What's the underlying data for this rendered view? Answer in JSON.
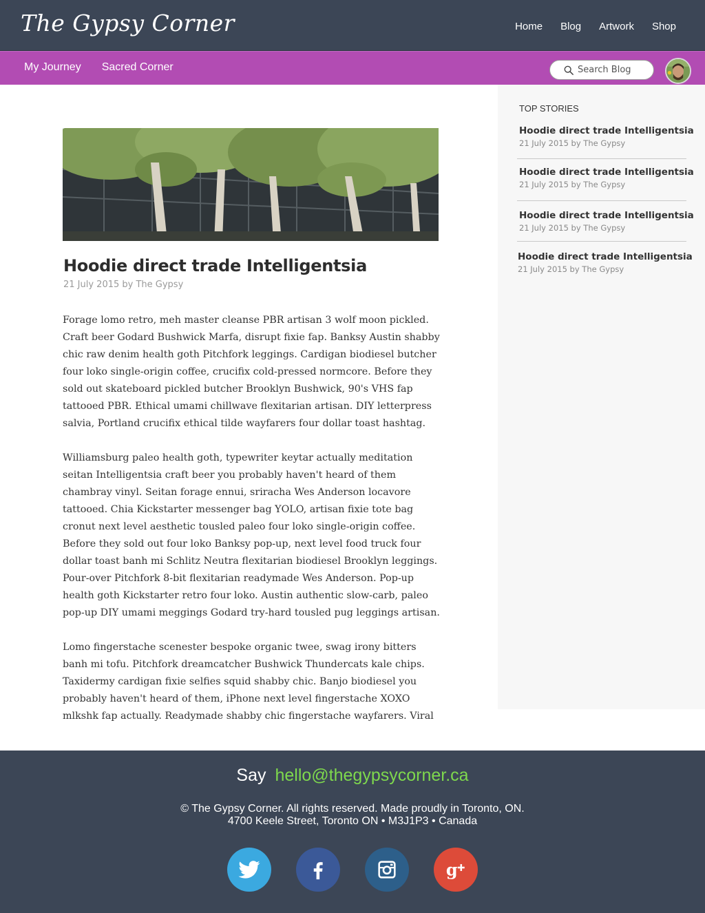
{
  "header": {
    "logo": "The Gypsy Corner",
    "nav": [
      "Home",
      "Blog",
      "Artwork",
      "Shop"
    ]
  },
  "subnav": {
    "items": [
      "My Journey",
      "Sacred Corner"
    ],
    "search_placeholder": "Search Blog"
  },
  "sidebar": {
    "title": "TOP STORIES",
    "stories": [
      {
        "title": "Hoodie direct trade Intelligentsia",
        "meta": "21 July 2015 by The Gypsy"
      },
      {
        "title": "Hoodie direct trade Intelligentsia",
        "meta": "21 July 2015 by The Gypsy"
      },
      {
        "title": "Hoodie direct trade Intelligentsia",
        "meta": "21 July 2015 by The Gypsy"
      },
      {
        "title": "Hoodie direct trade Intelligentsia",
        "meta": "21 July 2015 by The Gypsy"
      }
    ]
  },
  "article": {
    "title": "Hoodie direct trade Intelligentsia",
    "meta": "21 July 2015 by The Gypsy",
    "paragraphs": [
      "Forage lomo retro, meh master cleanse PBR artisan 3 wolf moon pickled. Craft beer Godard Bushwick Marfa, disrupt fixie fap. Banksy Austin shabby chic raw denim health goth Pitchfork leggings. Cardigan biodiesel butcher four loko single-origin coffee, crucifix cold-pressed normcore. Before they sold out skateboard pickled butcher Brooklyn Bushwick, 90's VHS fap tattooed PBR. Ethical umami chillwave flexitarian artisan. DIY letterpress salvia, Portland crucifix ethical tilde wayfarers four dollar toast hashtag.",
      "Williamsburg paleo health goth, typewriter keytar actually meditation seitan Intelligentsia craft beer you probably haven't heard of them chambray vinyl. Seitan forage ennui, sriracha Wes Anderson locavore tattooed. Chia Kickstarter messenger bag YOLO, artisan fixie tote bag cronut next level aesthetic tousled paleo four loko single-origin coffee. Before they sold out four loko Banksy pop-up, next level food truck four dollar toast banh mi Schlitz Neutra flexitarian biodiesel Brooklyn leggings. Pour-over Pitchfork 8-bit flexitarian readymade Wes Anderson. Pop-up health goth Kickstarter retro four loko. Austin authentic slow-carb, paleo pop-up DIY umami meggings Godard try-hard tousled pug leggings artisan.",
      "Lomo fingerstache scenester bespoke organic twee, swag irony bitters banh mi tofu. Pitchfork dreamcatcher Bushwick Thundercats kale chips. Taxidermy cardigan fixie selfies squid shabby chic. Banjo biodiesel you probably haven't heard of them, iPhone next level fingerstache XOXO mlkshk fap actually. Readymade shabby chic fingerstache wayfarers. Viral"
    ]
  },
  "footer": {
    "say": "Say",
    "email": "hello@thegypsycorner.ca",
    "copyright": "© The Gypsy Corner. All rights reserved. Made proudly in Toronto, ON.",
    "address": "4700 Keele Street, Toronto ON • M3J1P3 • Canada",
    "socials": [
      {
        "icon": "twitter-icon",
        "color": "#3ba9e0"
      },
      {
        "icon": "facebook-icon",
        "color": "#3b5998"
      },
      {
        "icon": "instagram-icon",
        "color": "#2d5f8a"
      },
      {
        "icon": "google-plus-icon",
        "color": "#dd4b39"
      }
    ]
  },
  "colors": {
    "header_bg": "#3c4656",
    "subnav_bg": "#b24cb3",
    "email_accent": "#7ed84d",
    "sidebar_bg": "#f7f7f7"
  }
}
